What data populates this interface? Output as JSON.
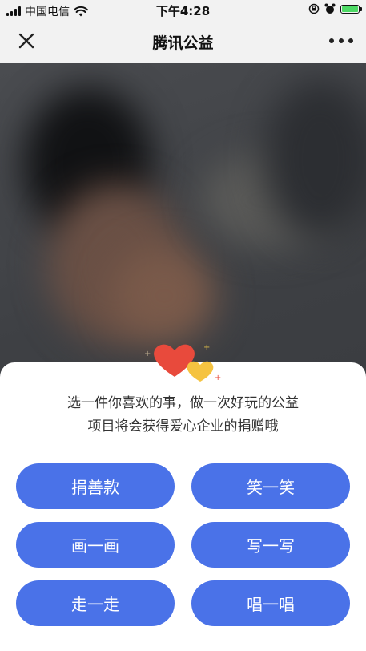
{
  "status_bar": {
    "carrier": "中国电信",
    "time": "下午4:28"
  },
  "nav": {
    "title": "腾讯公益",
    "close_icon": "close-icon",
    "more_icon": "more-icon"
  },
  "prompt": {
    "line1": "选一件你喜欢的事，做一次好玩的公益",
    "line2": "项目将会获得爱心企业的捐赠哦"
  },
  "actions": {
    "donate": "捐善款",
    "laugh": "笑一笑",
    "draw": "画一画",
    "write": "写一写",
    "walk": "走一走",
    "sing": "唱一唱"
  },
  "colors": {
    "button": "#4a72e8",
    "heart_red": "#e84a3c",
    "heart_yellow": "#f5c341"
  }
}
